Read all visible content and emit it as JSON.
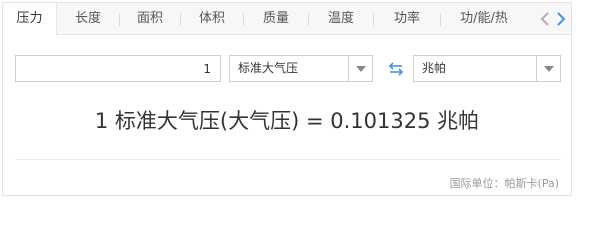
{
  "tabs": [
    {
      "label": "压力",
      "active": true
    },
    {
      "label": "长度",
      "active": false
    },
    {
      "label": "面积",
      "active": false
    },
    {
      "label": "体积",
      "active": false
    },
    {
      "label": "质量",
      "active": false
    },
    {
      "label": "温度",
      "active": false
    },
    {
      "label": "功率",
      "active": false
    },
    {
      "label": "功/能/热",
      "active": false
    }
  ],
  "converter": {
    "input_value": "1",
    "from_unit": "标准大气压",
    "to_unit": "兆帕"
  },
  "result_text": "1 标准大气压(大气压) = 0.101325 兆帕",
  "footnote": "国际单位：帕斯卡(Pa)",
  "colors": {
    "accent": "#4a90e2",
    "border": "#cfcfcf",
    "tab_bar_bg": "#f7f7f7",
    "muted_text": "#999999"
  },
  "icons": [
    "chevron-left-icon",
    "chevron-right-icon",
    "dropdown-arrow-icon",
    "swap-arrows-icon"
  ]
}
